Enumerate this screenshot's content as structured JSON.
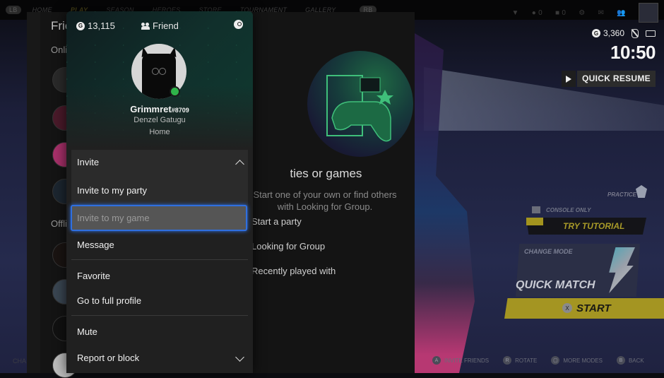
{
  "top_nav": {
    "lb": "LB",
    "rb": "RB",
    "items": [
      "Home",
      "Play",
      "Season",
      "Heroes",
      "Store",
      "Tournament",
      "Gallery"
    ],
    "active": "Play",
    "currency_a": "0",
    "currency_b": "0"
  },
  "friends_panel": {
    "title": "Friends",
    "online_label": "Online",
    "offline_label": "Offline"
  },
  "profile_card": {
    "gamerscore": "13,115",
    "relationship": "Friend",
    "gamertag": "Grimmret",
    "gamertag_suffix": "#8709",
    "real_name": "Denzel Gatugu",
    "presence": "Home",
    "status_color": "#2fb34a",
    "menu": {
      "invite_header": "Invite",
      "invite_party": "Invite to my party",
      "invite_game": "Invite to my game",
      "message": "Message",
      "favorite": "Favorite",
      "full_profile": "Go to full profile",
      "mute": "Mute",
      "report": "Report or block"
    }
  },
  "parties_panel": {
    "title": "No joinable parties or games",
    "subtitle": "Start one of your own or find others with Looking for Group.",
    "actions": [
      "Start a party",
      "Looking for Group",
      "Recently played with"
    ]
  },
  "system_overlay": {
    "gamerscore": "3,360",
    "time": "10:50",
    "quick_resume": "QUICK RESUME"
  },
  "game_ui": {
    "practice": "PRACTICE",
    "console_only": "CONSOLE ONLY",
    "try_tutorial": "TRY TUTORIAL",
    "change_mode": "CHANGE MODE",
    "quick_match": "QUICK MATCH",
    "start_button": "X",
    "start": "START",
    "char_label": "CHA"
  },
  "hints": [
    {
      "button": "A",
      "label": "INVITE FRIENDS"
    },
    {
      "button": "R",
      "label": "ROTATE"
    },
    {
      "button": "▢",
      "label": "MORE MODES"
    },
    {
      "button": "B",
      "label": "BACK"
    }
  ],
  "colors": {
    "focus_ring": "#2f6fe0",
    "start_yellow": "#a49522",
    "online_green": "#2fb34a"
  }
}
